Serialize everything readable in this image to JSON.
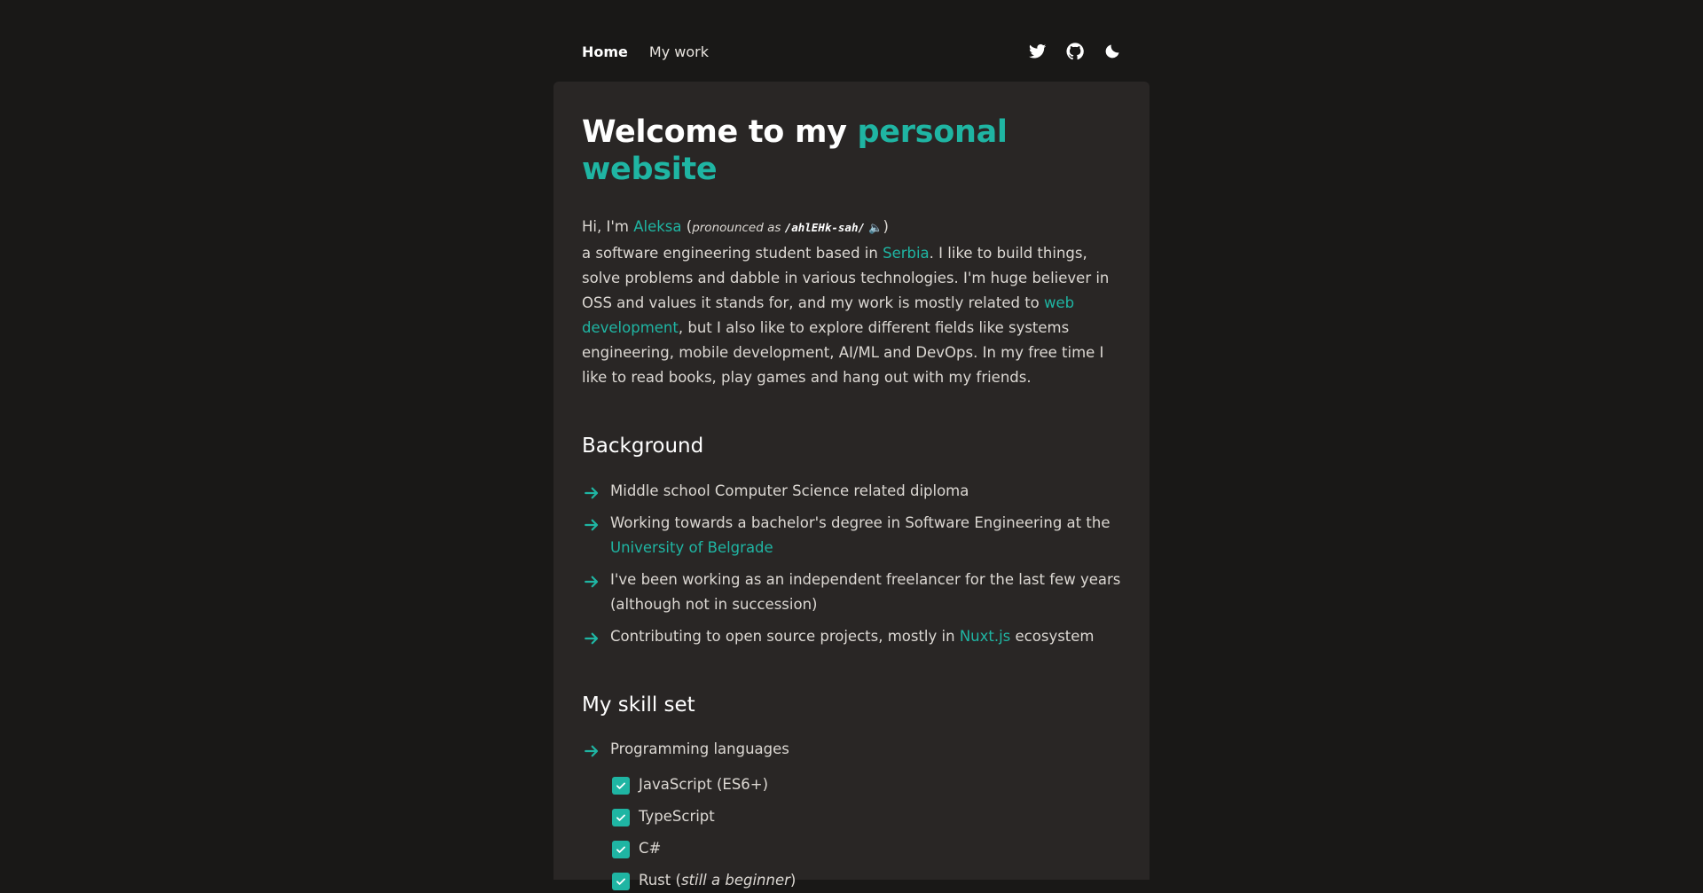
{
  "nav": {
    "links": [
      {
        "label": "Home"
      },
      {
        "label": "My work"
      }
    ],
    "icons": [
      "twitter-icon",
      "github-icon",
      "moon-icon"
    ]
  },
  "hero": {
    "title_prefix": "Welcome to my ",
    "title_accent": "personal website"
  },
  "intro": {
    "greeting": "Hi, I'm ",
    "name": "Aleksa",
    "open_paren": " (",
    "pronounced": "pronounced as ",
    "phonetic": "/ahlEHk-sah/",
    "close_paren": ")",
    "line2_a": "a software engineering student based in ",
    "country": "Serbia",
    "line2_b": ". I like to build things, solve problems and dabble in various technologies. I'm huge believer in OSS and values it stands for, and my work is mostly related to ",
    "field": "web development",
    "line2_c": ", but I also like to explore different fields like systems engineering, mobile development, AI/ML and DevOps. In my free time I like to read books, play games and hang out with my friends."
  },
  "background": {
    "heading": "Background",
    "items": [
      {
        "text": "Middle school Computer Science related diploma"
      },
      {
        "text": "Working towards a bachelor's degree in Software Engineering at the ",
        "link": "University of Belgrade"
      },
      {
        "text": "I've been working as an independent freelancer for the last few years (although not in succession)"
      },
      {
        "text": "Contributing to open source projects, mostly in ",
        "link": "Nuxt.js",
        "after": " ecosystem"
      }
    ]
  },
  "skills": {
    "heading": "My skill set",
    "group_label": "Programming languages",
    "languages": [
      {
        "name": "JavaScript (ES6+)"
      },
      {
        "name": "TypeScript"
      },
      {
        "name": "C#"
      },
      {
        "name": "Rust (",
        "note": "still a beginner",
        "after": ")"
      }
    ]
  },
  "colors": {
    "accent": "#1fb5a3",
    "page_bg": "#191817",
    "card_bg": "#292625"
  }
}
